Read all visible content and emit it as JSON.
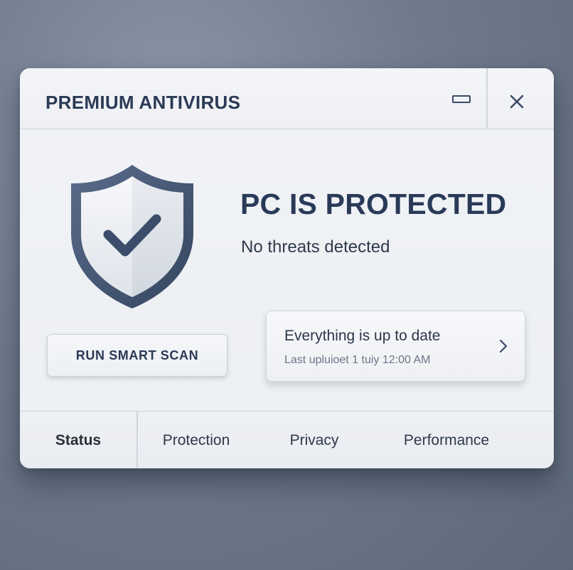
{
  "window": {
    "title": "PREMIUM ANTIVIRUS",
    "minimize_icon": "minimize-icon",
    "close_icon": "close-icon"
  },
  "status": {
    "shield_icon": "shield-check-icon",
    "heading": "PC IS PROTECTED",
    "subtext": "No threats detected"
  },
  "actions": {
    "scan_button_label": "RUN SMART SCAN"
  },
  "update_card": {
    "title": "Everything is up to date",
    "subtitle": "Last upluioet  1 tuiy 12:00 AM",
    "chevron_icon": "chevron-right-icon"
  },
  "tabs": [
    {
      "label": "Status",
      "active": true
    },
    {
      "label": "Protection",
      "active": false
    },
    {
      "label": "Privacy",
      "active": false
    },
    {
      "label": "Performance",
      "active": false
    }
  ],
  "colors": {
    "accent": "#2b3a55",
    "shield": "#3f5170",
    "background": "#6f7b8d",
    "window": "#eceff3"
  }
}
